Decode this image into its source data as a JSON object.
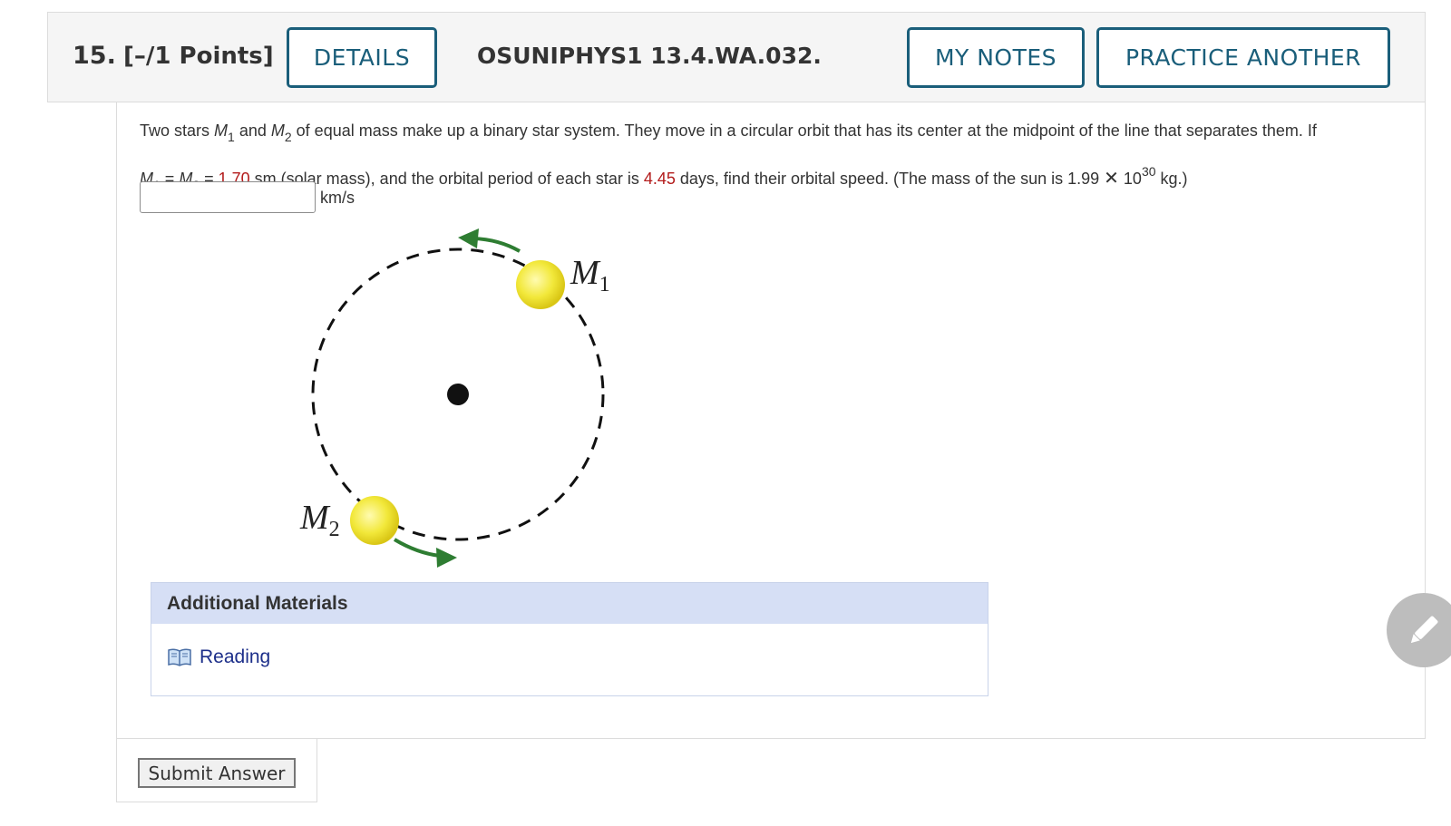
{
  "header": {
    "question_number": "15.",
    "points": "[–/1 Points]",
    "details_label": "DETAILS",
    "problem_code": "OSUNIPHYS1 13.4.WA.032.",
    "my_notes_label": "MY NOTES",
    "practice_another_label": "PRACTICE ANOTHER"
  },
  "question": {
    "l1_a": "Two stars ",
    "l1_m": "M",
    "l1_m1_sub": "1",
    "l1_and": " and ",
    "l1_m2": "M",
    "l1_m2_sub": "2",
    "l1_b": " of equal mass make up a binary star system. They move in a circular orbit that has its center at the midpoint of the line that separates them. If",
    "l2_m1": "M",
    "l2_m1_sub": "1",
    "l2_eq1": " = ",
    "l2_m2": "M",
    "l2_m2_sub": "2",
    "l2_eq2": " = ",
    "mass_value": "1.70",
    "l2_a": " sm (solar mass), and the orbital period of each star is ",
    "period_value": "4.45",
    "l2_b": " days, find their orbital speed. (The mass of the sun is 1.99 ",
    "times": "✕",
    "l2_ten": " 10",
    "l2_exp": "30",
    "l2_c": " kg.)",
    "answer_value": "",
    "unit": "km/s"
  },
  "diagram": {
    "label_m1": "M",
    "label_m1_sub": "1",
    "label_m2": "M",
    "label_m2_sub": "2"
  },
  "materials": {
    "title": "Additional Materials",
    "reading_label": "Reading"
  },
  "submit": {
    "label": "Submit Answer"
  },
  "colors": {
    "accent": "#1a5e7a",
    "value_red": "#b31b1b",
    "materials_header": "#d6dff5",
    "arrow_green": "#2e7d32",
    "star_yellow": "#f2e83a"
  }
}
